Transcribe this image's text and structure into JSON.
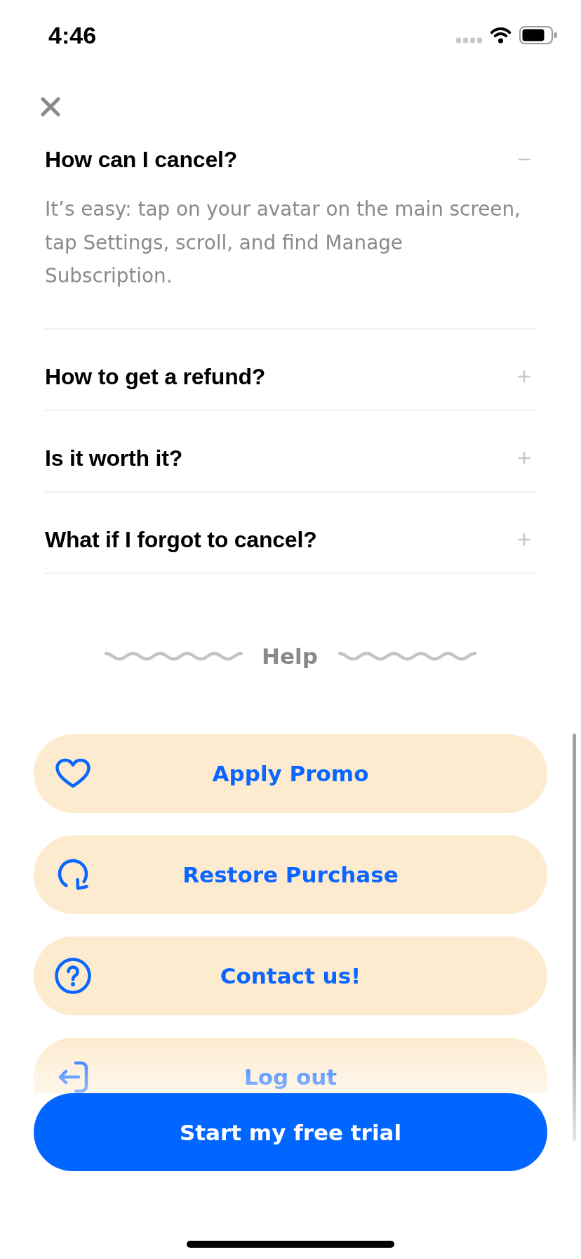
{
  "status_bar": {
    "time": "4:46"
  },
  "faq": [
    {
      "question": "How can I cancel?",
      "expanded": true,
      "answer": "It’s easy: tap on your avatar on the main screen, tap Settings, scroll, and find Manage Subscription."
    },
    {
      "question": "How to get a refund?",
      "expanded": false
    },
    {
      "question": "Is it worth it?",
      "expanded": false
    },
    {
      "question": "What if I forgot to cancel?",
      "expanded": false
    }
  ],
  "help": {
    "title": "Help"
  },
  "help_buttons": [
    {
      "kind": "promo",
      "label": "Apply Promo"
    },
    {
      "kind": "restore",
      "label": "Restore Purchase"
    },
    {
      "kind": "contact",
      "label": "Contact us!"
    },
    {
      "kind": "logout",
      "label": "Log out"
    }
  ],
  "primary_button": {
    "label": "Start my free trial"
  }
}
